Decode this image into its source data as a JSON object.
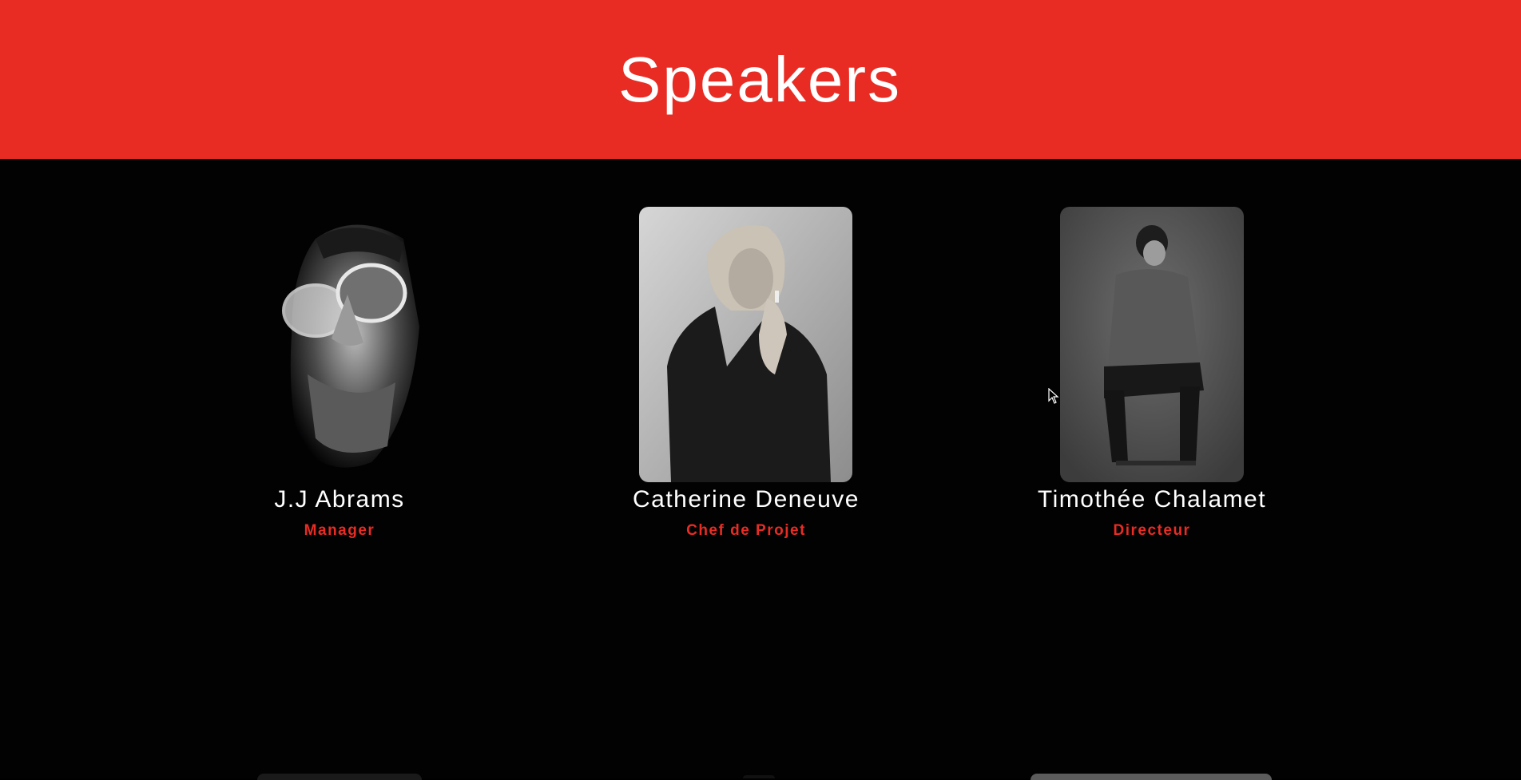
{
  "header": {
    "title": "Speakers",
    "background_color": "#e82c24"
  },
  "speakers": [
    {
      "name": "J.J Abrams",
      "role": "Manager",
      "photo_icon": "portrait-man-sunglasses"
    },
    {
      "name": "Catherine Deneuve",
      "role": "Chef de Projet",
      "photo_icon": "portrait-woman-lighter"
    },
    {
      "name": "Timothée Chalamet",
      "role": "Directeur",
      "photo_icon": "portrait-man-seated"
    }
  ],
  "colors": {
    "accent": "#e82c24",
    "page_background": "#020203",
    "text": "#ffffff"
  }
}
